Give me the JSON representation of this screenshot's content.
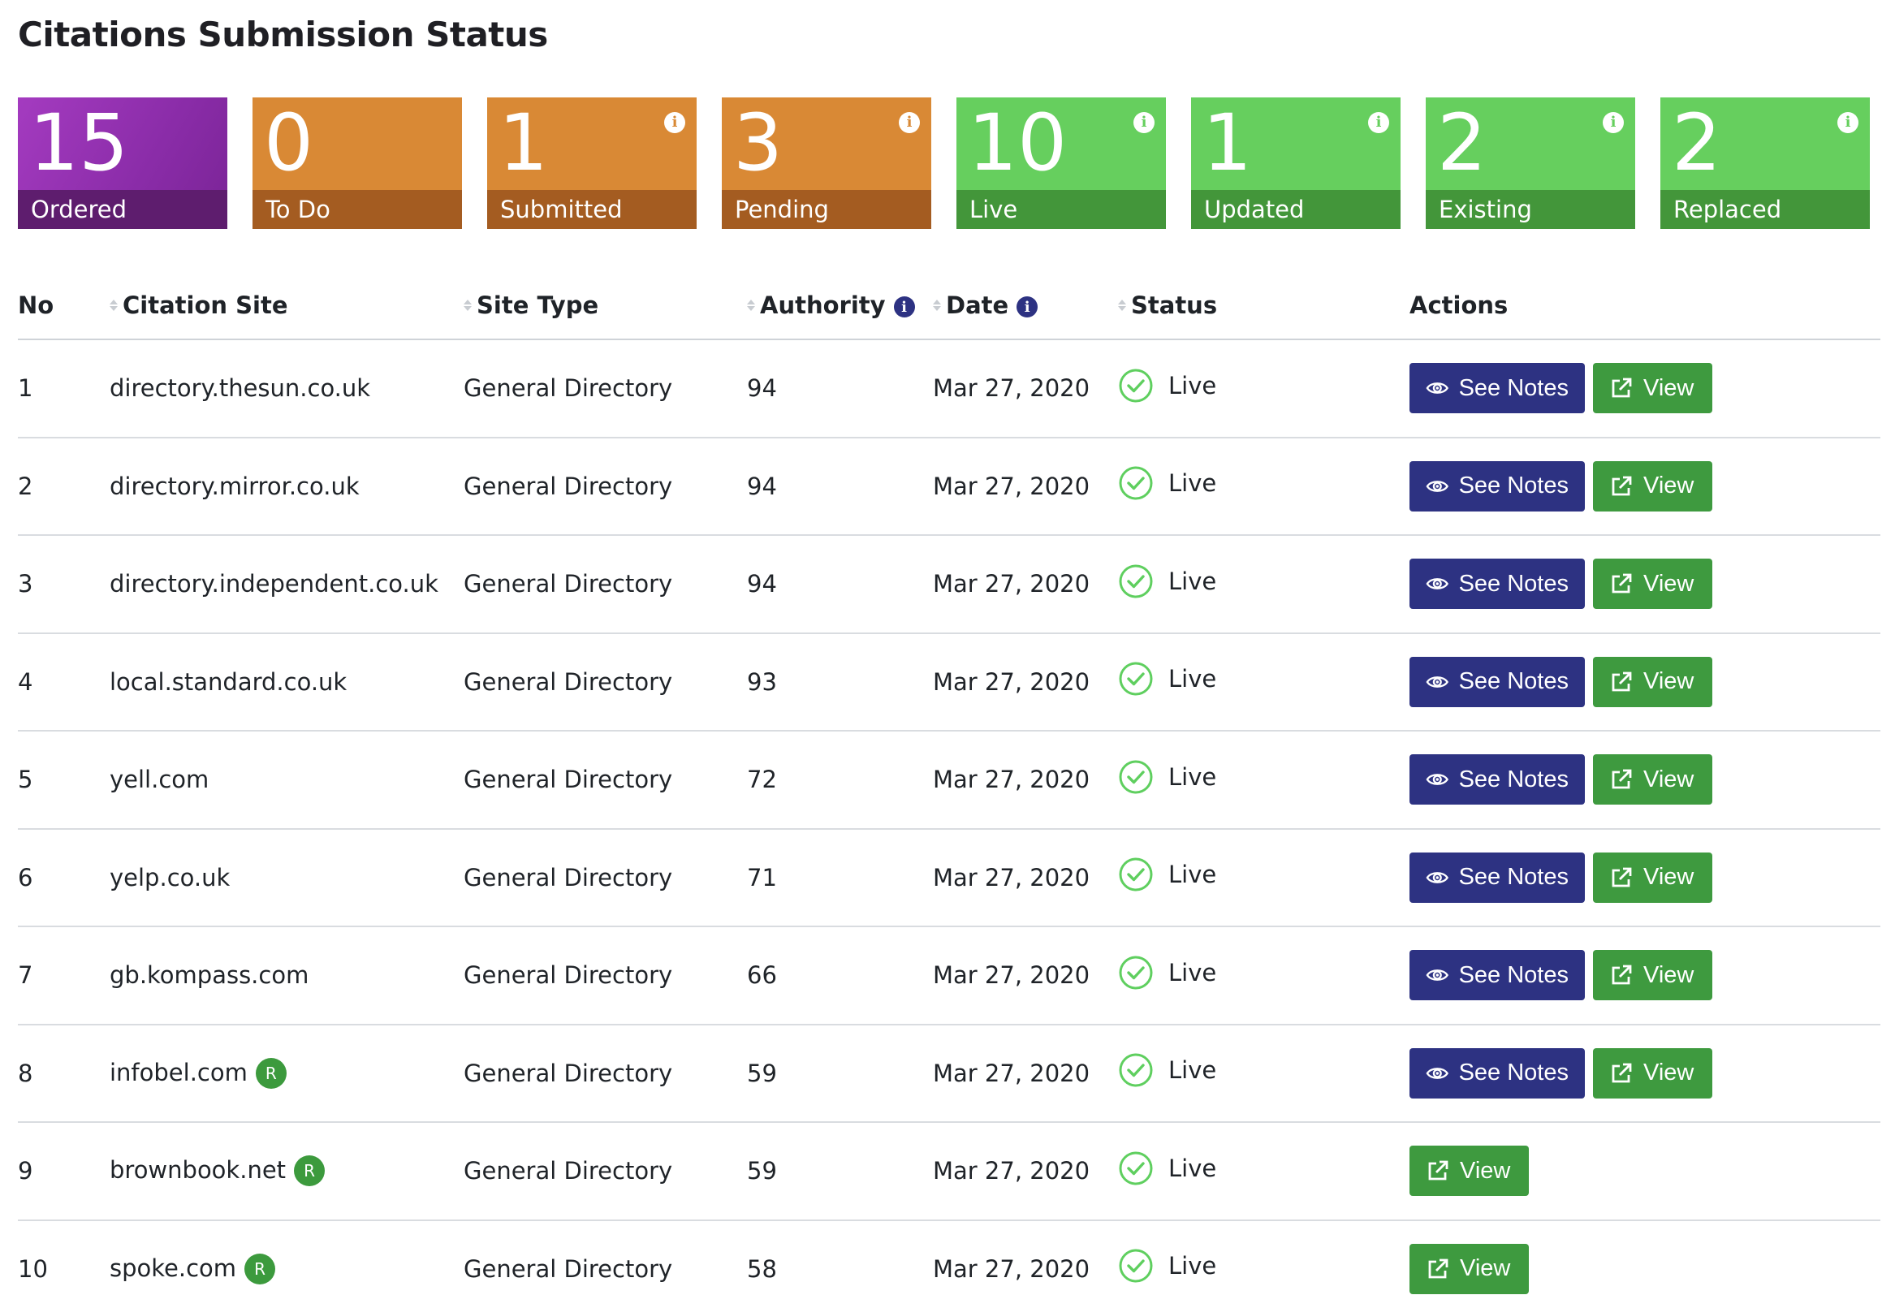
{
  "page": {
    "title": "Citations Submission Status"
  },
  "cards": [
    {
      "value": "15",
      "label": "Ordered",
      "color": "purple",
      "info": false
    },
    {
      "value": "0",
      "label": "To Do",
      "color": "orange",
      "info": false
    },
    {
      "value": "1",
      "label": "Submitted",
      "color": "orange",
      "info": true
    },
    {
      "value": "3",
      "label": "Pending",
      "color": "orange",
      "info": true
    },
    {
      "value": "10",
      "label": "Live",
      "color": "green",
      "info": true
    },
    {
      "value": "1",
      "label": "Updated",
      "color": "green",
      "info": true
    },
    {
      "value": "2",
      "label": "Existing",
      "color": "green",
      "info": true
    },
    {
      "value": "2",
      "label": "Replaced",
      "color": "green",
      "info": true
    }
  ],
  "colors": {
    "purple": "#9b35b8",
    "orange": "#d98935",
    "green": "#66cf5e",
    "navy": "#2d3282",
    "view_green": "#3e9a3f",
    "status_green": "#5fcf5f"
  },
  "table": {
    "headers": {
      "no": "No",
      "site": "Citation Site",
      "type": "Site Type",
      "authority": "Authority",
      "date": "Date",
      "status": "Status",
      "actions": "Actions"
    },
    "buttons": {
      "notes": "See Notes",
      "view": "View"
    },
    "badge_label": "R",
    "rows": [
      {
        "no": "1",
        "site": "directory.thesun.co.uk",
        "badge": false,
        "type": "General Directory",
        "authority": "94",
        "date": "Mar 27, 2020",
        "status": "Live",
        "notes": true
      },
      {
        "no": "2",
        "site": "directory.mirror.co.uk",
        "badge": false,
        "type": "General Directory",
        "authority": "94",
        "date": "Mar 27, 2020",
        "status": "Live",
        "notes": true
      },
      {
        "no": "3",
        "site": "directory.independent.co.uk",
        "badge": false,
        "type": "General Directory",
        "authority": "94",
        "date": "Mar 27, 2020",
        "status": "Live",
        "notes": true
      },
      {
        "no": "4",
        "site": "local.standard.co.uk",
        "badge": false,
        "type": "General Directory",
        "authority": "93",
        "date": "Mar 27, 2020",
        "status": "Live",
        "notes": true
      },
      {
        "no": "5",
        "site": "yell.com",
        "badge": false,
        "type": "General Directory",
        "authority": "72",
        "date": "Mar 27, 2020",
        "status": "Live",
        "notes": true
      },
      {
        "no": "6",
        "site": "yelp.co.uk",
        "badge": false,
        "type": "General Directory",
        "authority": "71",
        "date": "Mar 27, 2020",
        "status": "Live",
        "notes": true
      },
      {
        "no": "7",
        "site": "gb.kompass.com",
        "badge": false,
        "type": "General Directory",
        "authority": "66",
        "date": "Mar 27, 2020",
        "status": "Live",
        "notes": true
      },
      {
        "no": "8",
        "site": "infobel.com",
        "badge": true,
        "type": "General Directory",
        "authority": "59",
        "date": "Mar 27, 2020",
        "status": "Live",
        "notes": true
      },
      {
        "no": "9",
        "site": "brownbook.net",
        "badge": true,
        "type": "General Directory",
        "authority": "59",
        "date": "Mar 27, 2020",
        "status": "Live",
        "notes": false
      },
      {
        "no": "10",
        "site": "spoke.com",
        "badge": true,
        "type": "General Directory",
        "authority": "58",
        "date": "Mar 27, 2020",
        "status": "Live",
        "notes": false
      }
    ]
  }
}
